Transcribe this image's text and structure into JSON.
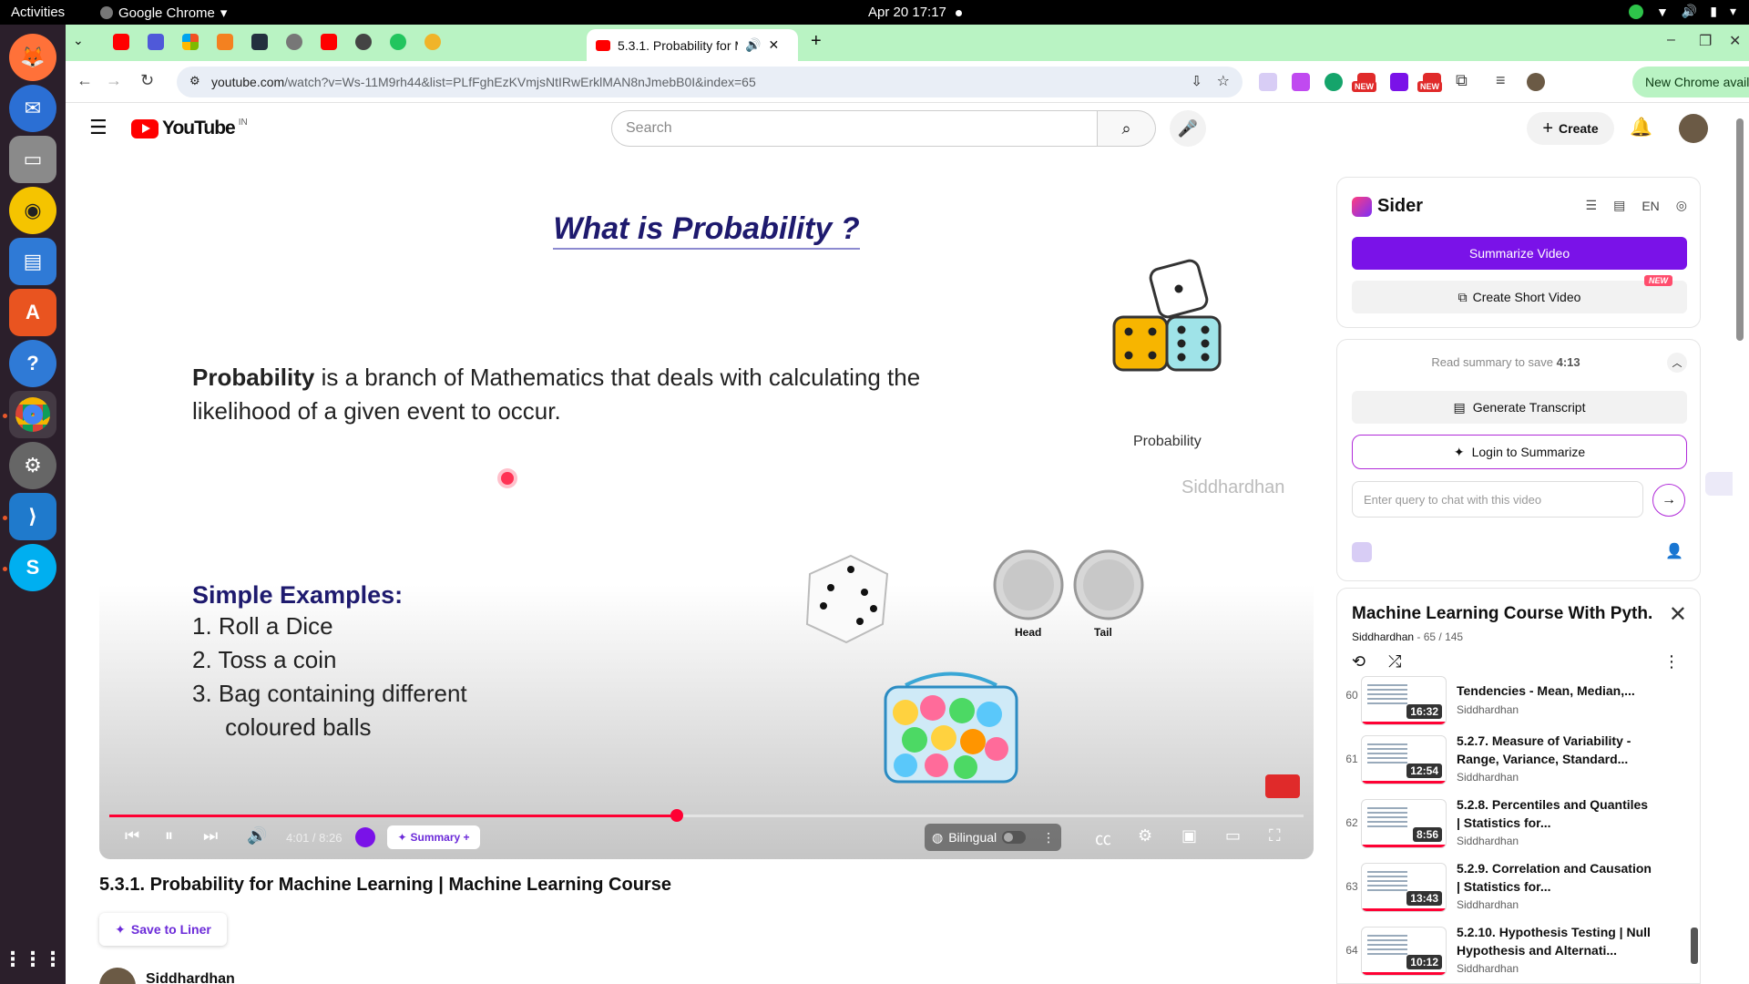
{
  "os": {
    "activities": "Activities",
    "app_name": "Google Chrome",
    "clock": "Apr 20  17:17"
  },
  "browser": {
    "active_tab_title": "5.3.1. Probability for M",
    "url_host": "youtube.com",
    "url_rest": "/watch?v=Ws-11M9rh44&list=PLfFghEzKVmjsNtIRwErklMAN8nJmebB0I&index=65",
    "new_chrome": "New Chrome available",
    "new_badge": "NEW"
  },
  "youtube": {
    "logo_text": "YouTube",
    "country": "IN",
    "search_placeholder": "Search",
    "create_label": "Create"
  },
  "video": {
    "slide_title": "What is  Probability ?",
    "def_bold": "Probability",
    "def_rest": " is a branch of Mathematics that deals with calculating the likelihood of a given event to occur.",
    "dice_caption": "Probability",
    "watermark": "Siddhardhan",
    "examples_heading": "Simple Examples:",
    "examples": [
      "1.  Roll a Dice",
      "2.  Toss a coin",
      "3.  Bag containing different",
      "     coloured balls"
    ],
    "coin_head": "Head",
    "coin_tail": "Tail",
    "timecode": "4:01 / 8:26",
    "progress": 0.475,
    "summary_label": "Summary +",
    "bilingual_label": "Bilingual",
    "title": "5.3.1. Probability for Machine Learning | Machine Learning Course",
    "save_liner": "Save to Liner",
    "channel": "Siddhardhan"
  },
  "sider": {
    "brand": "Sider",
    "lang": "EN",
    "summarize_video": "Summarize Video",
    "create_short_video": "Create Short Video",
    "new_badge": "NEW",
    "read_summary_prefix": "Read summary to save ",
    "read_summary_time": "4:13",
    "generate_transcript": "Generate Transcript",
    "login_to_summarize": "Login to Summarize",
    "chat_placeholder": "Enter query to chat with this video"
  },
  "playlist": {
    "title": "Machine Learning Course With Pyth...",
    "author": "Siddhardhan",
    "count": " - 65 / 145",
    "items": [
      {
        "index": "60",
        "duration": "16:32",
        "title": "Tendencies - Mean, Median,...",
        "channel": "Siddhardhan"
      },
      {
        "index": "61",
        "duration": "12:54",
        "title": "5.2.7. Measure of Variability - Range, Variance, Standard...",
        "channel": "Siddhardhan"
      },
      {
        "index": "62",
        "duration": "8:56",
        "title": "5.2.8. Percentiles and Quantiles | Statistics for...",
        "channel": "Siddhardhan"
      },
      {
        "index": "63",
        "duration": "13:43",
        "title": "5.2.9. Correlation and Causation | Statistics for...",
        "channel": "Siddhardhan"
      },
      {
        "index": "64",
        "duration": "10:12",
        "title": "5.2.10. Hypothesis Testing | Null Hypothesis and Alternati...",
        "channel": "Siddhardhan"
      }
    ]
  }
}
